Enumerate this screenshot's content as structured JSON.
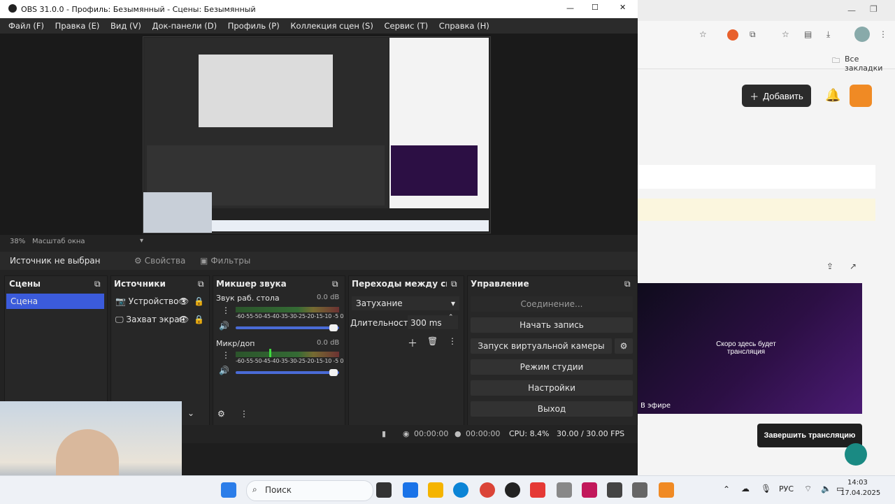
{
  "obs": {
    "title": "OBS 31.0.0 - Профиль: Безымянный - Сцены: Безымянный",
    "menu": [
      "Файл (F)",
      "Правка (E)",
      "Вид (V)",
      "Док-панели (D)",
      "Профиль (P)",
      "Коллекция сцен (S)",
      "Сервис (T)",
      "Справка (H)"
    ],
    "zoom_pct": "38%",
    "zoom_label": "Масштаб окна",
    "source_status": "Источник не выбран",
    "properties_label": "Свойства",
    "filters_label": "Фильтры",
    "scenes": {
      "title": "Сцены",
      "items": [
        "Сцена"
      ]
    },
    "sources": {
      "title": "Источники",
      "items": [
        "Устройство з",
        "Захват экран"
      ]
    },
    "mixer": {
      "title": "Микшер звука",
      "tick_labels": "-60-55-50-45-40-35-30-25-20-15-10 -5  0",
      "channels": [
        {
          "name": "Звук раб. стола",
          "db": "0.0 dB",
          "level": 1.0
        },
        {
          "name": "Микр/доп",
          "db": "0.0 dB",
          "level": 1.0
        }
      ]
    },
    "transitions": {
      "title": "Переходы между сцен...",
      "selected": "Затухание",
      "duration_label": "Длительность",
      "duration_value": "300 ms"
    },
    "controls": {
      "title": "Управление",
      "connection": "Соединение...",
      "start_recording": "Начать запись",
      "virtual_camera": "Запуск виртуальной камеры",
      "studio_mode": "Режим студии",
      "settings": "Настройки",
      "exit": "Выход"
    },
    "status": {
      "rec_time": "00:00:00",
      "stream_time": "00:00:00",
      "cpu": "CPU: 8.4%",
      "fps": "30.00 / 30.00 FPS"
    }
  },
  "browser": {
    "bookmarks_label": "Все закладки",
    "add_button": "Добавить",
    "stream_text": "Скоро здесь будет трансляция",
    "live_badge": "В эфире",
    "end_button": "Завершить трансляцию"
  },
  "taskbar": {
    "search_placeholder": "Поиск",
    "lang": "РУС",
    "time": "14:03",
    "date": "17.04.2025"
  },
  "colors": {
    "accent_blue": "#3b5bdb",
    "obs_bg": "#232323",
    "stream_purple": "#4b1b74"
  }
}
